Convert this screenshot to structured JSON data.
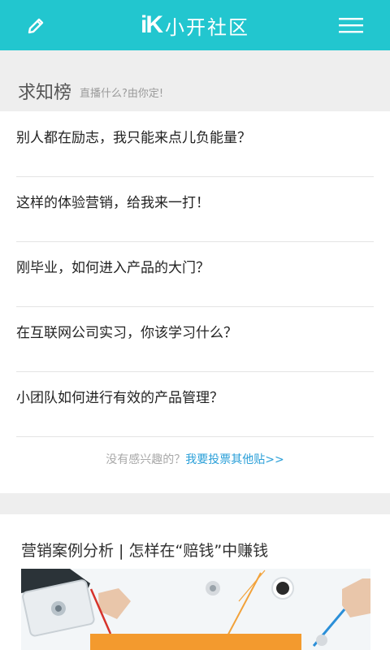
{
  "header": {
    "logo_mark": "iK",
    "title": "小开社区",
    "left_icon": "pencil-icon",
    "right_icon": "menu-icon",
    "bg_color": "#22c6cf"
  },
  "section": {
    "title": "求知榜",
    "subtitle": "直播什么?由你定!"
  },
  "questions": [
    "别人都在励志，我只能来点儿负能量？",
    "这样的体验营销，给我来一打！",
    "刚毕业，如何进入产品的大门？",
    "在互联网公司实习，你该学习什么？",
    "小团队如何进行有效的产品管理？"
  ],
  "more": {
    "prefix": "没有感兴趣的？",
    "link": "我要投票其他贴>>"
  },
  "article": {
    "title": "营销案例分析 | 怎样在“赔钱”中赚钱",
    "image_icon": "article-cover-image"
  }
}
